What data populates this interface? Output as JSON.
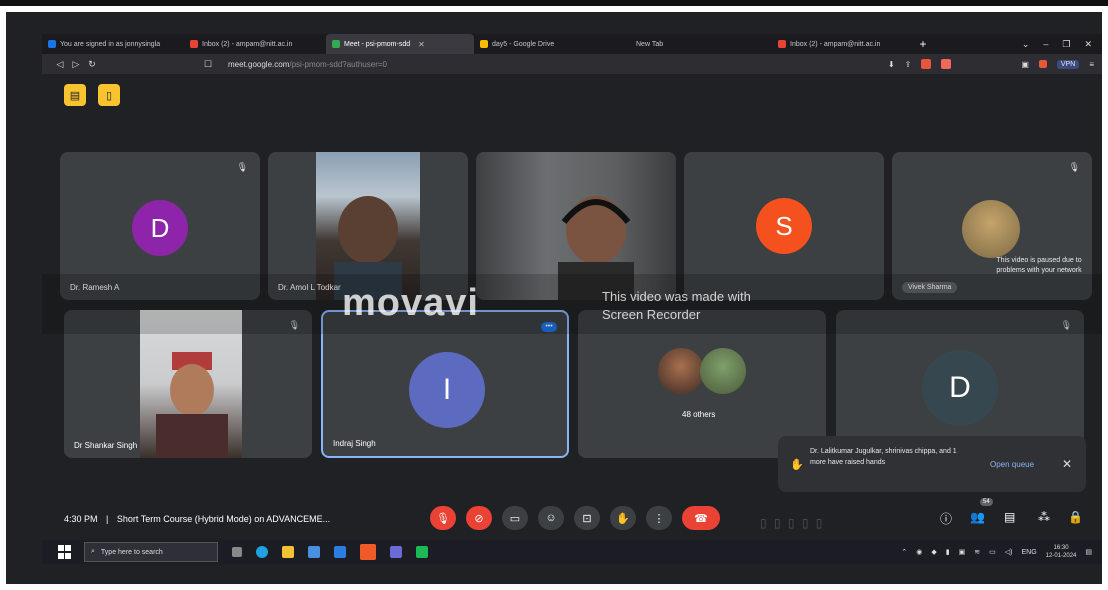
{
  "browser": {
    "tabs": [
      {
        "label": "You are signed in as jonnysingla",
        "color": "#1a73e8"
      },
      {
        "label": "Inbox (2) - ampam@nitt.ac.in",
        "color": "#ea4335"
      },
      {
        "label": "Meet - psi-pmom-sdd",
        "color": "#34a853",
        "active": true
      },
      {
        "label": "day5 - Google Drive",
        "color": "#fbbc04"
      },
      {
        "label": "New Tab",
        "color": "#5f6368"
      },
      {
        "label": "Inbox (2) - ampam@nitt.ac.in",
        "color": "#ea4335"
      }
    ],
    "new_tab": "+",
    "url_host": "meet.google.com",
    "url_path": "/psi-pmom-sdd?authuser=0",
    "vpn_label": "VPN"
  },
  "meet": {
    "tiles": [
      {
        "name": "Dr. Ramesh A",
        "initial": "D",
        "avatar_color": "#8e24aa"
      },
      {
        "name": "Dr. Amol L Todkar"
      },
      {
        "name": ""
      },
      {
        "name": "",
        "initial": "S",
        "avatar_color": "#f4511e"
      },
      {
        "name": "Vivek Sharma",
        "paused_text": "This video is paused due to problems with your network"
      },
      {
        "name": "Dr Shankar Singh"
      },
      {
        "name": "Indraj Singh",
        "initial": "I",
        "avatar_color": "#5c6bc0"
      },
      {
        "name": "",
        "others_label": "48 others"
      },
      {
        "name": "",
        "initial": "D",
        "avatar_color": "#37474f"
      }
    ],
    "watermark": {
      "logo": "movavi",
      "line1": "This video was made with",
      "line2": "Screen Recorder"
    },
    "notification": {
      "text": "Dr. Lalitkumar Jugulkar, shrinivas chippa, and 1 more have raised hands",
      "link": "Open queue"
    },
    "time": "4:30 PM",
    "separator": "|",
    "meeting_title": "Short Term Course (Hybrid Mode) on ADVANCEME...",
    "people_count": "54"
  },
  "taskbar": {
    "search_placeholder": "Type here to search",
    "lang": "ENG",
    "clock_time": "16:30",
    "clock_date": "12-01-2024"
  }
}
